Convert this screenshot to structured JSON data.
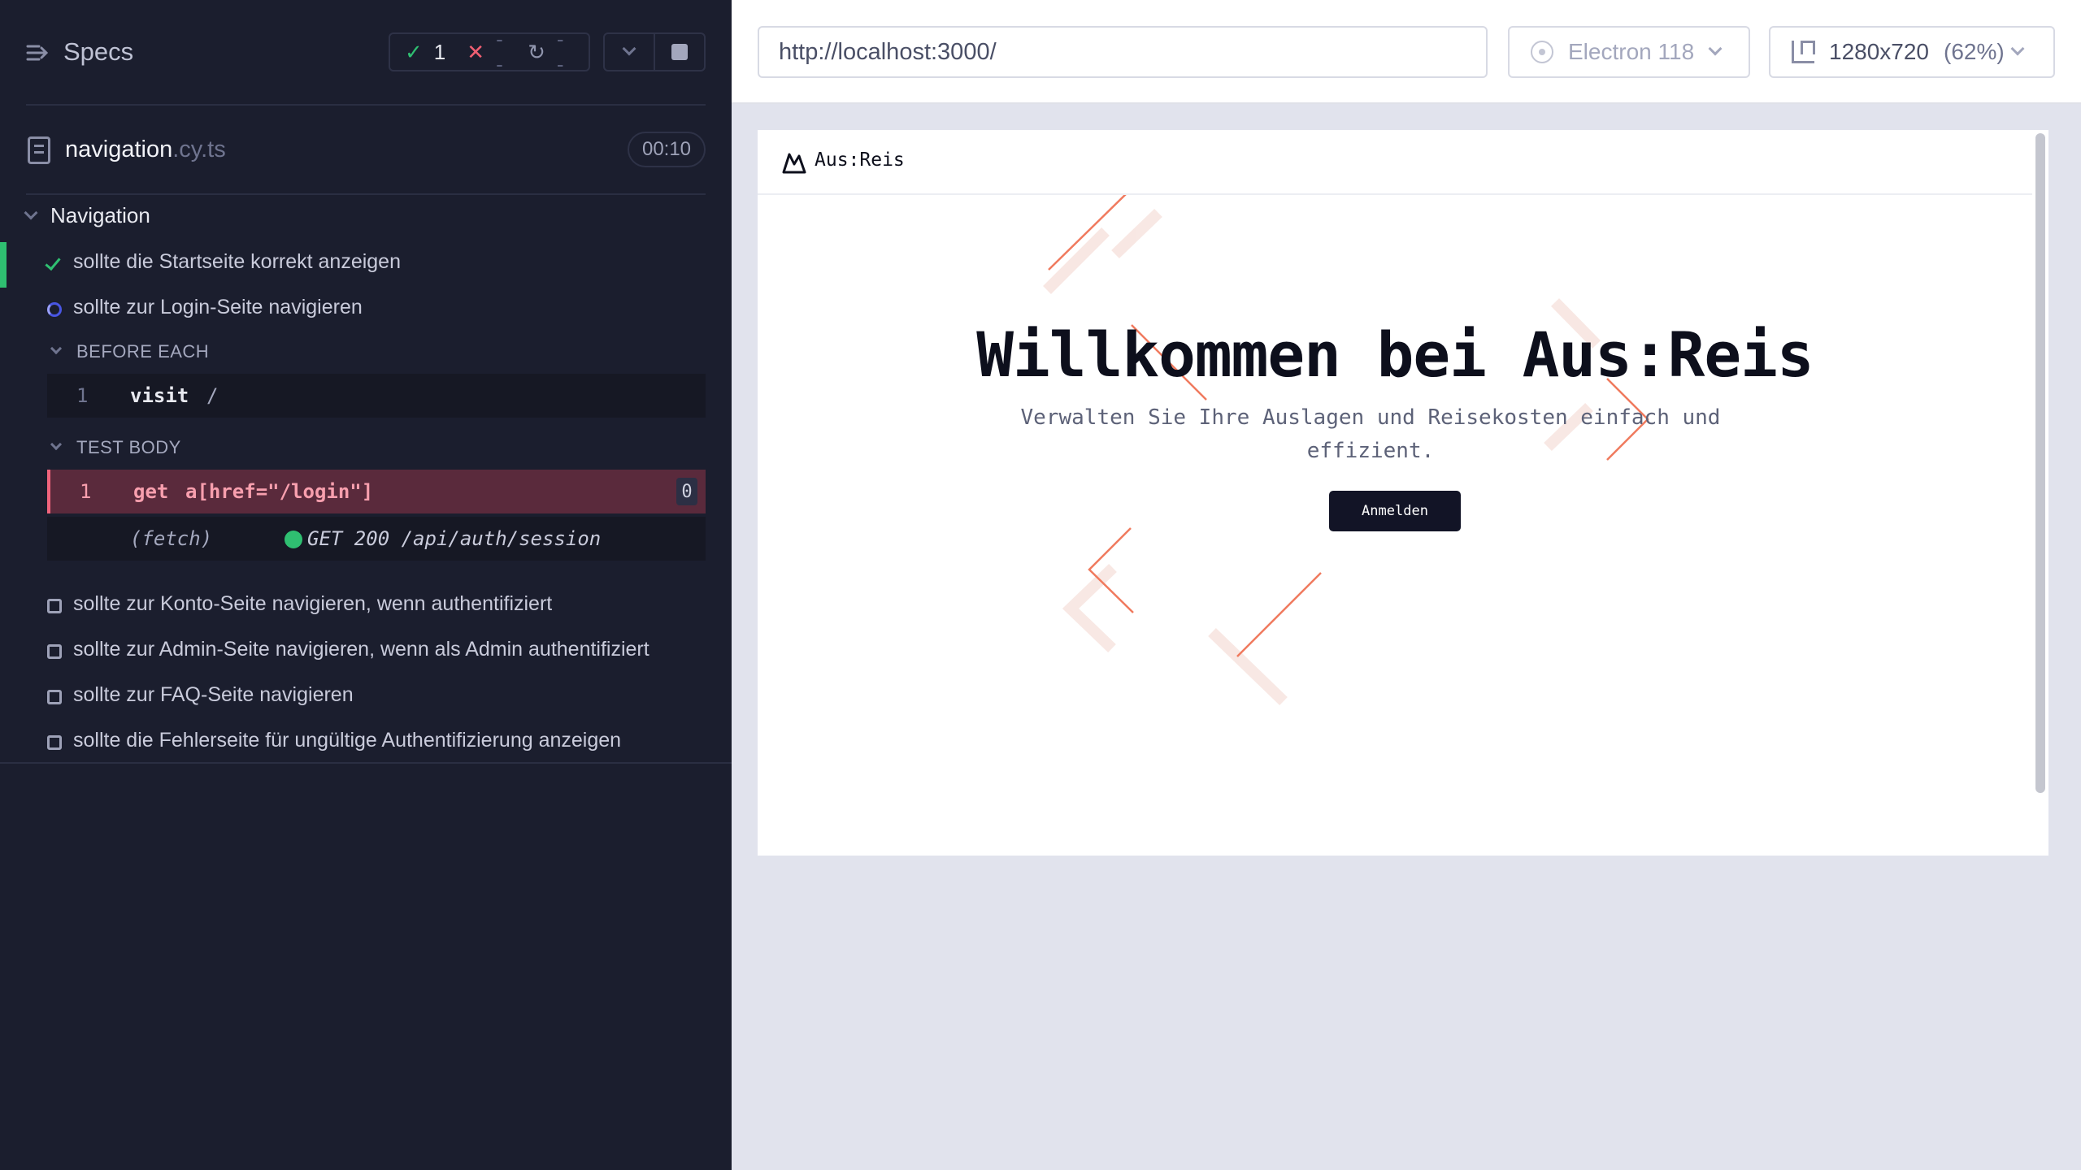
{
  "reporter": {
    "specs_label": "Specs",
    "stats": {
      "passed": "1",
      "failed": "--",
      "pending": "--"
    },
    "file": {
      "name": "navigation",
      "ext": ".cy.ts",
      "duration": "00:10"
    },
    "suite": {
      "title": "Navigation"
    },
    "tests": [
      {
        "title": "sollte die Startseite korrekt anzeigen",
        "state": "passed"
      },
      {
        "title": "sollte zur Login-Seite navigieren",
        "state": "running"
      },
      {
        "title": "sollte zur Konto-Seite navigieren, wenn authentifiziert",
        "state": "pending"
      },
      {
        "title": "sollte zur Admin-Seite navigieren, wenn als Admin authentifiziert",
        "state": "pending"
      },
      {
        "title": "sollte zur FAQ-Seite navigieren",
        "state": "pending"
      },
      {
        "title": "sollte die Fehlerseite für ungültige Authentifizierung anzeigen",
        "state": "pending"
      }
    ],
    "before_each": {
      "label": "BEFORE EACH",
      "commands": [
        {
          "num": "1",
          "name": "visit",
          "arg": "/"
        }
      ]
    },
    "test_body": {
      "label": "TEST BODY",
      "commands": [
        {
          "num": "1",
          "name": "get",
          "arg": "a[href=\"/login\"]",
          "count": "0"
        }
      ],
      "request": {
        "label": "(fetch)",
        "text": "GET 200 /api/auth/session"
      }
    }
  },
  "toolbar": {
    "url": "http://localhost:3000/",
    "browser": "Electron 118",
    "viewport": "1280x720",
    "scale": "(62%)"
  },
  "app": {
    "logo": "Aus:Reis",
    "hero_title": "Willkommen bei Aus:Reis",
    "hero_subtitle": "Verwalten Sie Ihre Auslagen und Reisekosten einfach und effizient.",
    "login_button": "Anmelden",
    "accent_color": "#f07a5e"
  }
}
